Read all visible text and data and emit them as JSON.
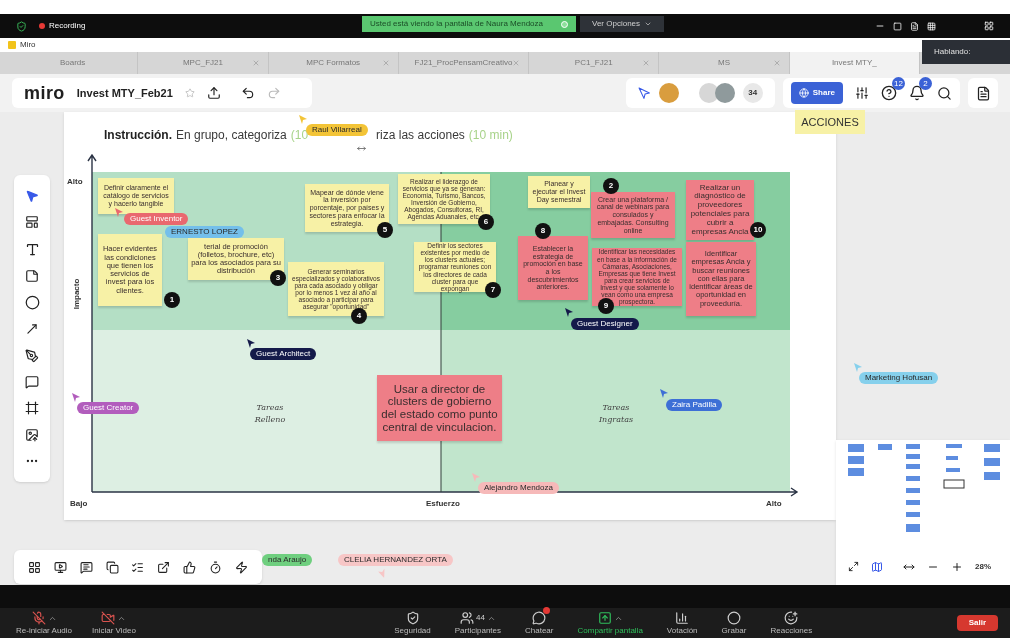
{
  "zoom_bar": {
    "recording": "Recording",
    "share_banner": "Usted está viendo la pantalla de Naura Mendoza",
    "options": "Ver Opciones"
  },
  "speaking_popup": "Hablando:",
  "app_title": "Miro",
  "browser_tabs": [
    {
      "label": "Boards",
      "selected": false,
      "closable": false
    },
    {
      "label": "MPC_FJ21",
      "selected": false,
      "closable": true
    },
    {
      "label": "MPC Formatos",
      "selected": false,
      "closable": true
    },
    {
      "label": "FJ21_ProcPensamCreativo",
      "selected": false,
      "closable": true
    },
    {
      "label": "PC1_FJ21",
      "selected": false,
      "closable": true
    },
    {
      "label": "MS",
      "selected": false,
      "closable": true
    },
    {
      "label": "Invest MTY_",
      "selected": true,
      "closable": false
    }
  ],
  "toolbar": {
    "logo": "miro",
    "board_name": "Invest MTY_Feb21",
    "collaborator_count": "34",
    "share": "Share",
    "help_badge": "12",
    "bell_badge": "2"
  },
  "board": {
    "heading_start": [
      {
        "text": "Instrucción.",
        "kind": "bold"
      },
      {
        "text": "En grupo, categoriza",
        "kind": "plain"
      },
      {
        "text": "(10",
        "kind": "hint"
      }
    ],
    "heading_end": [
      {
        "text": "riza las acciones",
        "kind": "plain"
      },
      {
        "text": "(10 min)",
        "kind": "hint"
      }
    ],
    "actions_note": "ACCIONES",
    "axes": {
      "y_high": "Alto",
      "y_label": "Impacto",
      "y_low": "Bajo",
      "x_label": "Esfuerzo",
      "x_high": "Alto"
    },
    "quadrant_labels": [
      "Tareas Relleno",
      "Tareas Ingratas"
    ],
    "notes": [
      {
        "text": "Definir claramente el catálogo de servicios y hacerlo tangible",
        "color": "#f7f1a6"
      },
      {
        "text": "Mapear de dónde viene la inversión por porcentaje, por países y sectores para enfocar la estrategia.",
        "color": "#f7f1a6",
        "badge": "5"
      },
      {
        "text": "Realizar el liderazgo de servicios que ya se generan: Economía, Turismo, Bancos, Inversión de Gobierno, Abogados, Consultoras, RI, Agencias Aduanales, etc.",
        "color": "#f7f1a6",
        "badge": "6"
      },
      {
        "text": "Planear y ejecutar el Invest Day semestral",
        "color": "#f7f1a6"
      },
      {
        "text": "Crear una plataforma / canal de webinars para consulados y embajadas. Consulting online",
        "color": "#ee7e87",
        "badge": "2"
      },
      {
        "text": "Realizar un diagnóstico de proveedores potenciales para cubrir a empresas Ancla",
        "color": "#ee7e87",
        "badge": "10"
      },
      {
        "text": "Hacer evidentes las condiciones que tienen los servicios de invest para los clientes.",
        "color": "#f7f1a6",
        "badge": "1"
      },
      {
        "text": "terial de promoción (folletos, brochure, etc) para los asociados para su distribución",
        "color": "#f7f1a6",
        "badge": "3"
      },
      {
        "text": "Generar seminarios especializados y colaborativos para cada asociado y obligar por lo menos 1 vez al año al asociado a participar para asegurar \"oportunidad\"",
        "color": "#f7f1a6",
        "badge": "4"
      },
      {
        "text": "Definir los sectores existentes por medio de los clusters actuales; programar reuniones con los directores de cada cluster para que expongan",
        "color": "#f7f1a6",
        "badge": "7"
      },
      {
        "text": "Establecer la estrategia de promoción en base a los descubrimientos anteriores.",
        "color": "#ee7e87",
        "badge": "8"
      },
      {
        "text": "Identificar las necesidades en base a la información de Cámaras, Asociaciones, Empresas que tiene Invest para crear servicios de Invest y que solamente lo vean como una empresa prospectora.",
        "color": "#ee7e87",
        "badge": "9"
      },
      {
        "text": "Identificar empresas Ancla y buscar reuniones con ellas para identificar áreas de oportunidad en proveeduría.",
        "color": "#ee7e87"
      },
      {
        "text": "Usar a director de clusters de gobierno del estado como punto central de vinculacion.",
        "color": "#ee7e87"
      }
    ],
    "cursors": [
      {
        "name": "Raul Villarreal",
        "color": "#f3c437"
      },
      {
        "name": "Guest Inventor",
        "color": "#e9686f"
      },
      {
        "name": "ERNESTO LOPEZ",
        "color": "#74bfea"
      },
      {
        "name": "Guest Designer",
        "color": "#141a4a"
      },
      {
        "name": "Guest Architect",
        "color": "#141a4a"
      },
      {
        "name": "Marketing Hofusan",
        "color": "#86d0ec"
      },
      {
        "name": "Guest Creator",
        "color": "#b25dbd"
      },
      {
        "name": "Zaira Padilla",
        "color": "#3d6fd6"
      },
      {
        "name": "Alejandro Mendoza",
        "color": "#f6b9b9"
      },
      {
        "name": "nda Araujo",
        "color": "#6fcf7f"
      },
      {
        "name": "CLELIA HERNANDEZ ORTA",
        "color": "#f7c6c6"
      }
    ]
  },
  "zoom_level": "28%",
  "meeting_left": [
    {
      "label": "Re-iniciar Audio",
      "kind": "mic",
      "has_menu": true
    },
    {
      "label": "Iniciar Video",
      "kind": "video",
      "has_menu": true
    }
  ],
  "meeting_center": [
    {
      "label": "Seguridad",
      "kind": "security",
      "has_menu": false
    },
    {
      "label": "Participantes",
      "kind": "participants",
      "count": "44",
      "has_menu": true
    },
    {
      "label": "Chatear",
      "kind": "chat",
      "has_menu": false
    },
    {
      "label": "Compartir pantalla",
      "kind": "share",
      "has_menu": true
    },
    {
      "label": "Votación",
      "kind": "poll",
      "has_menu": false
    },
    {
      "label": "Grabar",
      "kind": "record",
      "has_menu": false
    },
    {
      "label": "Reacciones",
      "kind": "reactions",
      "has_menu": false
    }
  ],
  "leave": "Salir"
}
